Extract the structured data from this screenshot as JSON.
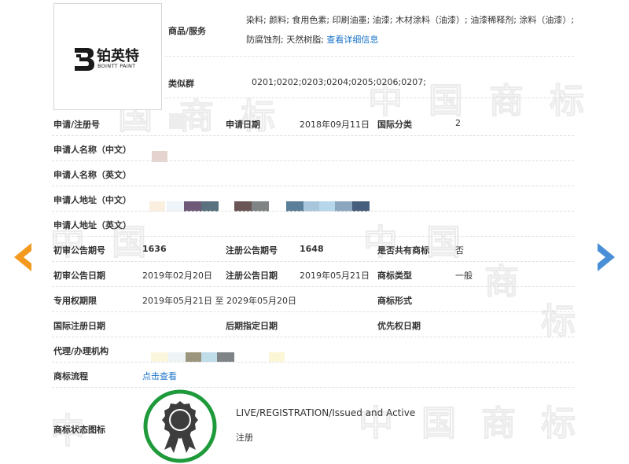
{
  "logo": {
    "brand_cn": "铂英特",
    "brand_en": "BOINTT PAINT"
  },
  "goods": {
    "label": "商品/服务",
    "text": "染料; 颜料; 食用色素; 印刷油墨; 油漆; 木材涂料（油漆）; 油漆稀释剂; 涂料（油漆）; 防腐蚀剂; 天然树脂;",
    "more_link": "查看详细信息"
  },
  "similar_group": {
    "label": "类似群",
    "value": "0201;0202;0203;0204;0205;0206;0207;"
  },
  "application": {
    "reg_no_label": "申请/注册号",
    "date_label": "申请日期",
    "date_value": "2018年09月11日",
    "intl_class_label": "国际分类",
    "intl_class_value": "2"
  },
  "applicant": {
    "name_cn_label": "申请人名称（中文）",
    "name_en_label": "申请人名称（英文）",
    "address_cn_label": "申请人地址（中文）",
    "address_en_label": "申请人地址（英文）"
  },
  "announcement": {
    "prelim_no_label": "初审公告期号",
    "prelim_no_value": "1636",
    "reg_no_label": "注册公告期号",
    "reg_no_value": "1648",
    "shared_label": "是否共有商标",
    "shared_value": "否",
    "prelim_date_label": "初审公告日期",
    "prelim_date_value": "2019年02月20日",
    "reg_date_label": "注册公告日期",
    "reg_date_value": "2019年05月21日",
    "type_label": "商标类型",
    "type_value": "一般"
  },
  "rights": {
    "period_label": "专用权期限",
    "period_value": "2019年05月21日 至 2029年05月20日",
    "form_label": "商标形式",
    "intl_reg_date_label": "国际注册日期",
    "later_designation_label": "后期指定日期",
    "priority_date_label": "优先权日期"
  },
  "agent": {
    "label": "代理/办理机构"
  },
  "process": {
    "label": "商标流程",
    "link": "点击查看"
  },
  "status": {
    "label": "商标状态图标",
    "english": "LIVE/REGISTRATION/Issued and Active",
    "chinese": "注册",
    "badge_color": "#1e9a3a"
  },
  "watermark_chars": [
    "中",
    "国",
    "商",
    "标"
  ],
  "colors": {
    "left_arrow": "#f39a1e",
    "right_arrow": "#4a8fd6",
    "link": "#1a73c8"
  }
}
